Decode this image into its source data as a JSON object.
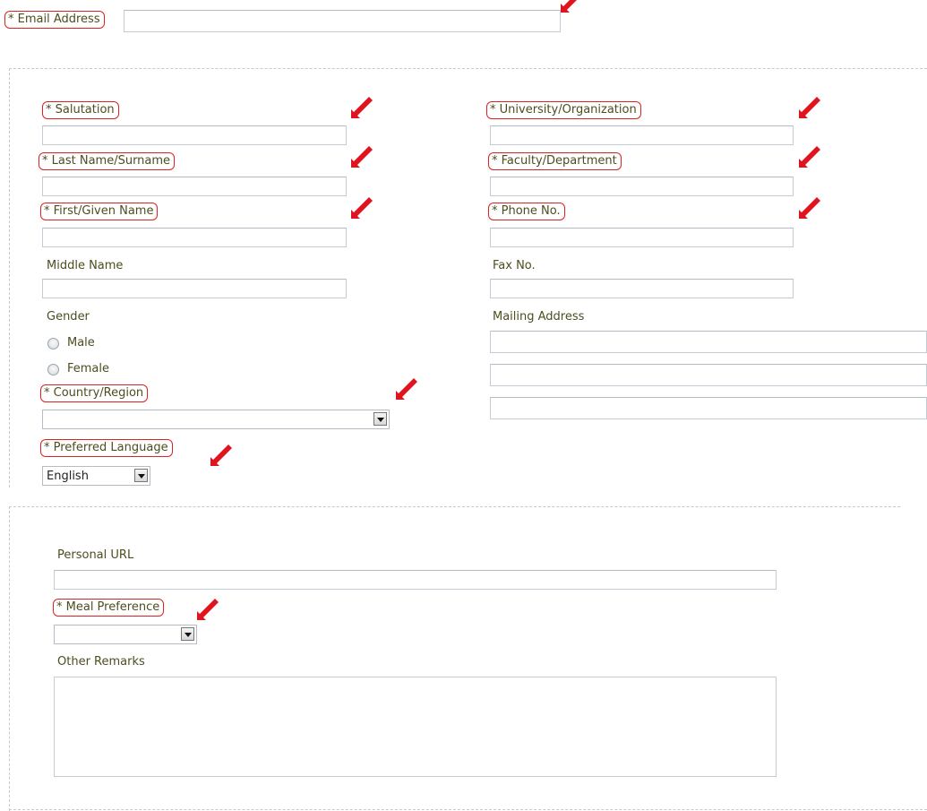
{
  "email": {
    "label": "* Email Address",
    "value": ""
  },
  "left": {
    "salutation": {
      "label": "* Salutation",
      "value": ""
    },
    "last_name": {
      "label": "* Last Name/Surname",
      "value": ""
    },
    "first_name": {
      "label": "* First/Given Name",
      "value": ""
    },
    "middle_name": {
      "label": "Middle Name",
      "value": ""
    },
    "gender": {
      "label": "Gender",
      "options": [
        "Male",
        "Female"
      ]
    },
    "country": {
      "label": "* Country/Region",
      "value": ""
    },
    "language": {
      "label": "* Preferred Language",
      "value": "English"
    }
  },
  "right": {
    "university": {
      "label": "* University/Organization",
      "value": ""
    },
    "faculty": {
      "label": "* Faculty/Department",
      "value": ""
    },
    "phone": {
      "label": "* Phone No.",
      "value": ""
    },
    "fax": {
      "label": "Fax No.",
      "value": ""
    },
    "mailing": {
      "label": "Mailing Address",
      "lines": [
        "",
        "",
        ""
      ]
    }
  },
  "bottom": {
    "personal_url": {
      "label": "Personal URL",
      "value": ""
    },
    "meal": {
      "label": "* Meal Preference",
      "value": ""
    },
    "remarks": {
      "label": "Other Remarks",
      "value": ""
    }
  },
  "colors": {
    "annotation": "#e0141e",
    "label_text": "#4d4d1f",
    "field_border": "#c4cbd4"
  },
  "icons": {
    "annotation_arrow": "red-arrow-icon",
    "dropdown": "chevron-down-icon"
  }
}
